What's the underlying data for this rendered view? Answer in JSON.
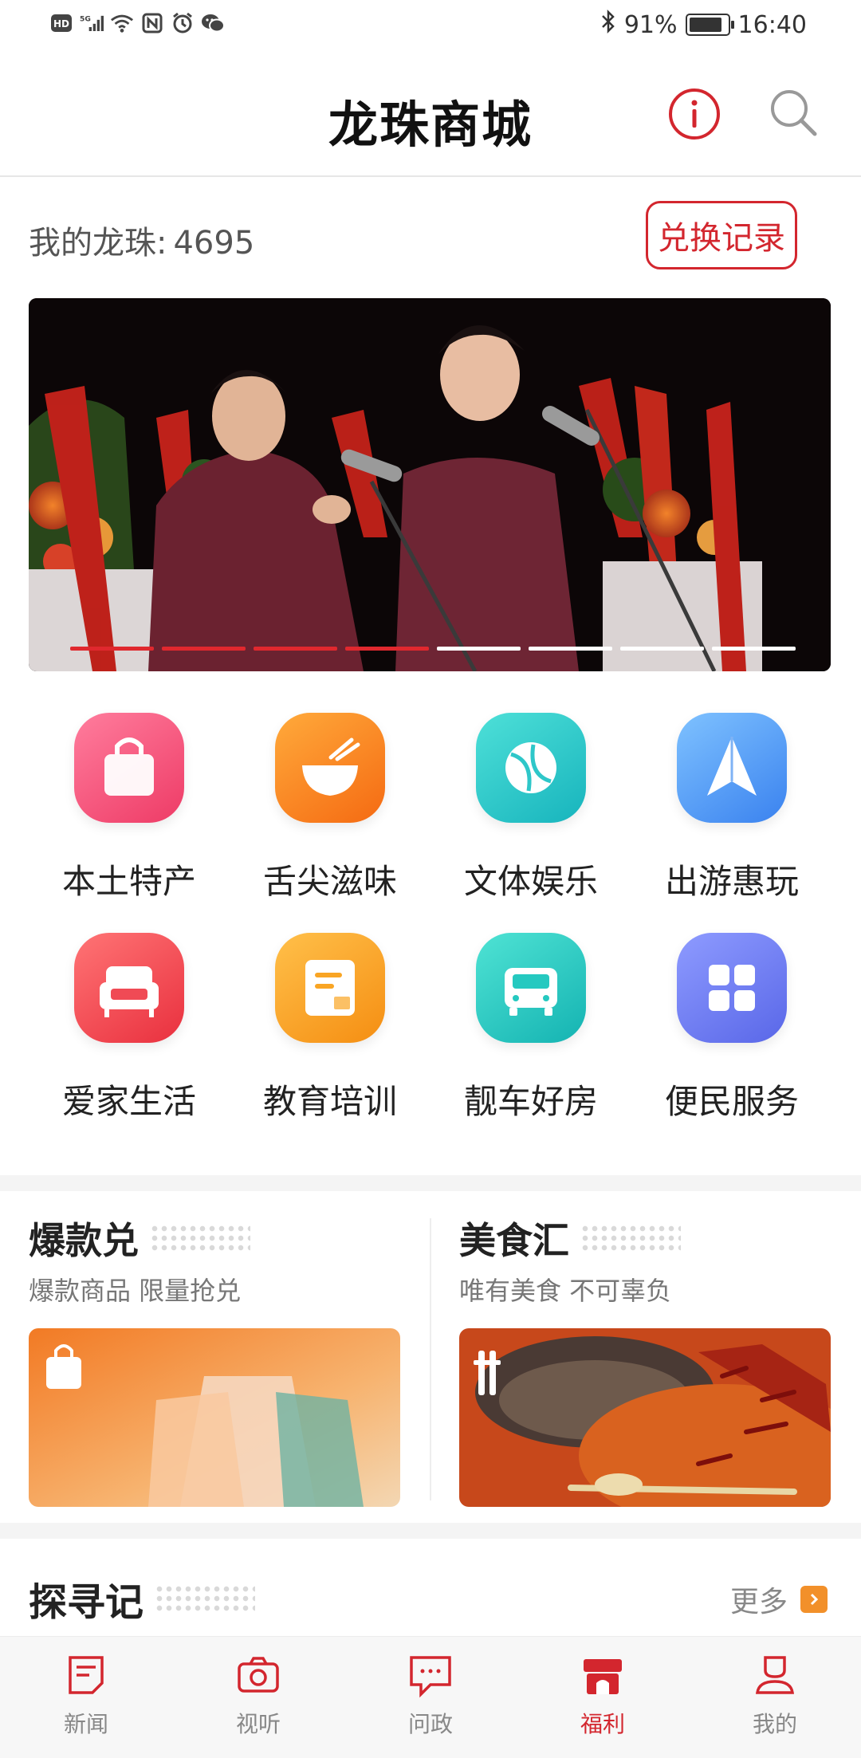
{
  "status_bar": {
    "left_icons": [
      "hd-icon",
      "5g-signal-icon",
      "wifi-icon",
      "nfc-icon",
      "alarm-icon",
      "wechat-icon"
    ],
    "bluetooth": "bluetooth-icon",
    "battery_percent": "91%",
    "battery_level": 0.91,
    "time": "16:40"
  },
  "header": {
    "title": "龙珠商城",
    "info_icon": "info-icon",
    "search_icon": "search-icon"
  },
  "points": {
    "label": "我的龙珠:",
    "value": "4695",
    "exchange_button": "兑换记录"
  },
  "banner": {
    "slide_count": 8,
    "active_slides": 4
  },
  "categories": [
    {
      "label": "本土特产",
      "icon": "shopping-bag-icon",
      "color": "#f2527a"
    },
    {
      "label": "舌尖滋味",
      "icon": "bowl-icon",
      "color": "#f98b1e"
    },
    {
      "label": "文体娱乐",
      "icon": "ball-icon",
      "color": "#2ec7c9"
    },
    {
      "label": "出游惠玩",
      "icon": "navigation-icon",
      "color": "#5aa0f5"
    },
    {
      "label": "爱家生活",
      "icon": "sofa-icon",
      "color": "#f04a55"
    },
    {
      "label": "教育培训",
      "icon": "certificate-icon",
      "color": "#f9a524"
    },
    {
      "label": "靓车好房",
      "icon": "car-icon",
      "color": "#25c9c0"
    },
    {
      "label": "便民服务",
      "icon": "grid-icon",
      "color": "#6d7cf0"
    }
  ],
  "promos": [
    {
      "title": "爆款兑",
      "subtitle": "爆款商品 限量抢兑",
      "icon": "shopping-bag-icon"
    },
    {
      "title": "美食汇",
      "subtitle": "唯有美食 不可辜负",
      "icon": "chopsticks-icon"
    }
  ],
  "explore": {
    "title": "探寻记",
    "more": "更多"
  },
  "nav": [
    {
      "label": "新闻",
      "icon": "news-icon",
      "active": false
    },
    {
      "label": "视听",
      "icon": "camera-icon",
      "active": false
    },
    {
      "label": "问政",
      "icon": "message-icon",
      "active": false
    },
    {
      "label": "福利",
      "icon": "welfare-icon",
      "active": true
    },
    {
      "label": "我的",
      "icon": "profile-icon",
      "active": false
    }
  ],
  "colors": {
    "accent": "#d3262e",
    "banner_dot_active": "#e0282e",
    "banner_dot_inactive": "#ffffff"
  }
}
